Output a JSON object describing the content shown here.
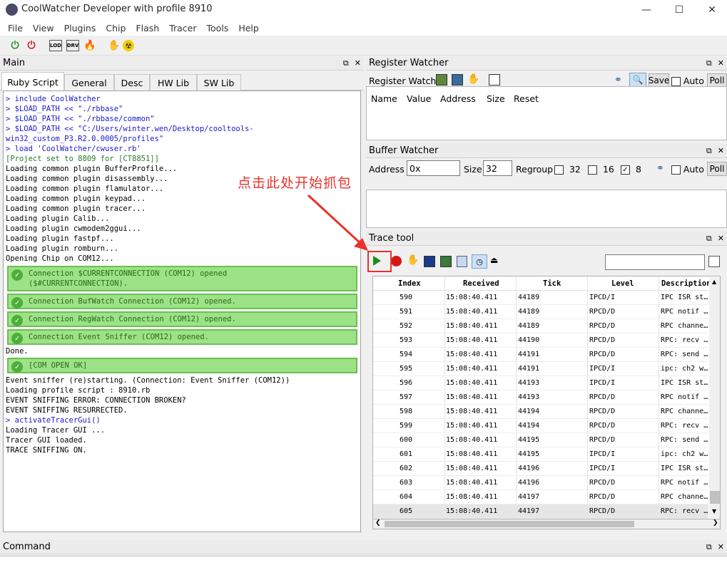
{
  "window": {
    "title": "CoolWatcher Developer with profile 8910",
    "minimize": "—",
    "maximize": "☐",
    "close": "✕"
  },
  "menu": [
    "File",
    "View",
    "Plugins",
    "Chip",
    "Flash",
    "Tracer",
    "Tools",
    "Help"
  ],
  "toolbar": {
    "icons": [
      "power-on-icon",
      "power-off-icon",
      "lod-icon",
      "drv-icon",
      "burn-icon",
      "handshake-icon",
      "radiation-icon"
    ],
    "lod": "LOD",
    "drv": "DRV"
  },
  "main": {
    "title": "Main",
    "tabs": [
      "Ruby Script",
      "General",
      "Desc",
      "HW Lib",
      "SW Lib"
    ],
    "lines": [
      {
        "t": "> include CoolWatcher",
        "c": "blue"
      },
      {
        "t": "> $LOAD_PATH << \"./rbbase\"",
        "c": "blue"
      },
      {
        "t": "> $LOAD_PATH << \"./rbbase/common\"",
        "c": "blue"
      },
      {
        "t": "> $LOAD_PATH << \"C:/Users/winter.wen/Desktop/cooltools-",
        "c": "blue"
      },
      {
        "t": "win32_custom_P3.R2.0.0005/profiles\"",
        "c": "blue"
      },
      {
        "t": "> load 'CoolWatcher/cwuser.rb'",
        "c": "blue"
      },
      {
        "t": "[Project set to 8809 for [CT8851]]",
        "c": "green"
      },
      {
        "t": "Loading common plugin BufferProfile...",
        "c": ""
      },
      {
        "t": "Loading common plugin disassembly...",
        "c": ""
      },
      {
        "t": "Loading common plugin flamulator...",
        "c": ""
      },
      {
        "t": "Loading common plugin keypad...",
        "c": ""
      },
      {
        "t": "Loading common plugin tracer...",
        "c": ""
      },
      {
        "t": "Loading plugin Calib...",
        "c": ""
      },
      {
        "t": "Loading plugin cwmodem2ggui...",
        "c": ""
      },
      {
        "t": "Loading plugin fastpf...",
        "c": ""
      },
      {
        "t": "Loading plugin romburn...",
        "c": ""
      },
      {
        "t": "Opening Chip on COM12...",
        "c": ""
      }
    ],
    "ok_boxes": [
      "Connection $CURRENTCONNECTION (COM12) opened\n($#CURRENTCONNECTION).",
      "Connection BufWatch Connection (COM12) opened.",
      "Connection RegWatch Connection (COM12) opened.",
      "Connection Event Sniffer (COM12) opened."
    ],
    "done": "Done.",
    "com_ok": "[COM OPEN OK]",
    "lines2": [
      {
        "t": "Event sniffer (re)starting. (Connection: Event Sniffer (COM12))",
        "c": ""
      },
      {
        "t": "Loading profile script : 8910.rb",
        "c": ""
      },
      {
        "t": "EVENT SNIFFING ERROR: CONNECTION BROKEN?",
        "c": ""
      },
      {
        "t": "EVENT SNIFFING RESURRECTED.",
        "c": ""
      },
      {
        "t": "> activateTracerGui()",
        "c": "blue"
      },
      {
        "t": "Loading Tracer GUI ...",
        "c": ""
      },
      {
        "t": "Tracer GUI loaded.",
        "c": ""
      },
      {
        "t": "TRACE SNIFFING ON.",
        "c": ""
      }
    ]
  },
  "register_watcher": {
    "title": "Register Watcher",
    "label": "Register Watch",
    "save": "Save",
    "auto": "Auto",
    "poll": "Poll",
    "columns": [
      "Name",
      "Value",
      "Address",
      "Size",
      "Reset"
    ]
  },
  "buffer_watcher": {
    "title": "Buffer Watcher",
    "address_label": "Address",
    "address_value": "0x",
    "size_label": "Size",
    "size_value": "32",
    "regroup_label": "Regroup",
    "regroup_options": [
      "32",
      "16",
      "8"
    ],
    "regroup_checked": "8",
    "auto": "Auto",
    "poll": "Poll"
  },
  "trace_tool": {
    "title": "Trace tool",
    "search_value": "",
    "columns": [
      "Index",
      "Received",
      "Tick",
      "Level",
      "Description"
    ],
    "rows": [
      [
        "590",
        "15:08:40.411",
        "44189",
        "IPCD/I",
        "IPC ISR st…"
      ],
      [
        "591",
        "15:08:40.411",
        "44189",
        "RPCD/D",
        "RPC notif …"
      ],
      [
        "592",
        "15:08:40.411",
        "44189",
        "RPCD/D",
        "RPC channe…"
      ],
      [
        "593",
        "15:08:40.411",
        "44190",
        "RPCD/D",
        "RPC: recv …"
      ],
      [
        "594",
        "15:08:40.411",
        "44191",
        "RPCD/D",
        "RPC: send …"
      ],
      [
        "595",
        "15:08:40.411",
        "44191",
        "IPCD/I",
        "ipc: ch2 w…"
      ],
      [
        "596",
        "15:08:40.411",
        "44193",
        "IPCD/I",
        "IPC ISR st…"
      ],
      [
        "597",
        "15:08:40.411",
        "44193",
        "RPCD/D",
        "RPC notif …"
      ],
      [
        "598",
        "15:08:40.411",
        "44194",
        "RPCD/D",
        "RPC channe…"
      ],
      [
        "599",
        "15:08:40.411",
        "44194",
        "RPCD/D",
        "RPC: recv …"
      ],
      [
        "600",
        "15:08:40.411",
        "44195",
        "RPCD/D",
        "RPC: send …"
      ],
      [
        "601",
        "15:08:40.411",
        "44195",
        "IPCD/I",
        "ipc: ch2 w…"
      ],
      [
        "602",
        "15:08:40.411",
        "44196",
        "IPCD/I",
        "IPC ISR st…"
      ],
      [
        "603",
        "15:08:40.411",
        "44196",
        "RPCD/D",
        "RPC notif …"
      ],
      [
        "604",
        "15:08:40.411",
        "44197",
        "RPCD/D",
        "RPC channe…"
      ],
      [
        "605",
        "15:08:40.411",
        "44197",
        "RPCD/D",
        "RPC: recv …"
      ]
    ],
    "selected_row": "605"
  },
  "command": {
    "title": "Command"
  },
  "annotation": {
    "text": "点击此处开始抓包",
    "color": "#e8322b"
  },
  "panel_buttons": {
    "float": "⧉",
    "close": "✕"
  }
}
